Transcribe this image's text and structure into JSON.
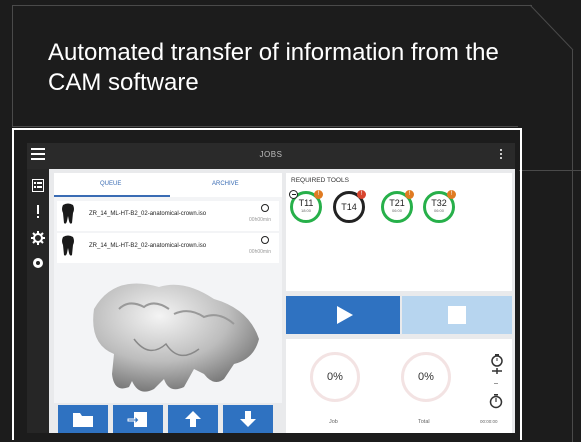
{
  "headline": "Automated transfer of information from the CAM software",
  "app": {
    "title": "JOBS"
  },
  "tabs": {
    "queue": "QUEUE",
    "archive": "ARCHIVE"
  },
  "queue": [
    {
      "name": "ZR_14_ML-HT-B2_02-anatomical-crown.iso",
      "time": "00h00min"
    },
    {
      "name": "ZR_14_ML-HT-B2_02-anatomical-crown.iso",
      "time": "00h00min"
    }
  ],
  "required_tools": {
    "title": "REQUIRED TOOLS",
    "tools": [
      {
        "id": "T11",
        "time": "18:00",
        "status_color": "#27b04a",
        "badge": "!"
      },
      {
        "id": "T14",
        "time": "",
        "status_color": "#222222",
        "badge": "!"
      },
      {
        "id": "T21",
        "time": "06:00",
        "status_color": "#27b04a",
        "badge": "!"
      },
      {
        "id": "T32",
        "time": "06:00",
        "status_color": "#27b04a",
        "badge": "!"
      }
    ]
  },
  "progress": {
    "job": {
      "value": "0%",
      "label": "Job"
    },
    "total": {
      "value": "0%",
      "label": "Total"
    },
    "elapsed": "00:00:00"
  },
  "colors": {
    "accent": "#2f72c1",
    "tool_ok": "#27b04a",
    "badge": "#e07b22"
  },
  "icons": [
    "menu-icon",
    "more-vert-icon",
    "jobs-list-icon",
    "exclamation-icon",
    "settings-icon",
    "disc-icon",
    "folder-icon",
    "import-icon",
    "arrow-up-icon",
    "arrow-down-icon",
    "play-icon",
    "stop-icon",
    "timer-icon",
    "stopwatch-icon"
  ]
}
